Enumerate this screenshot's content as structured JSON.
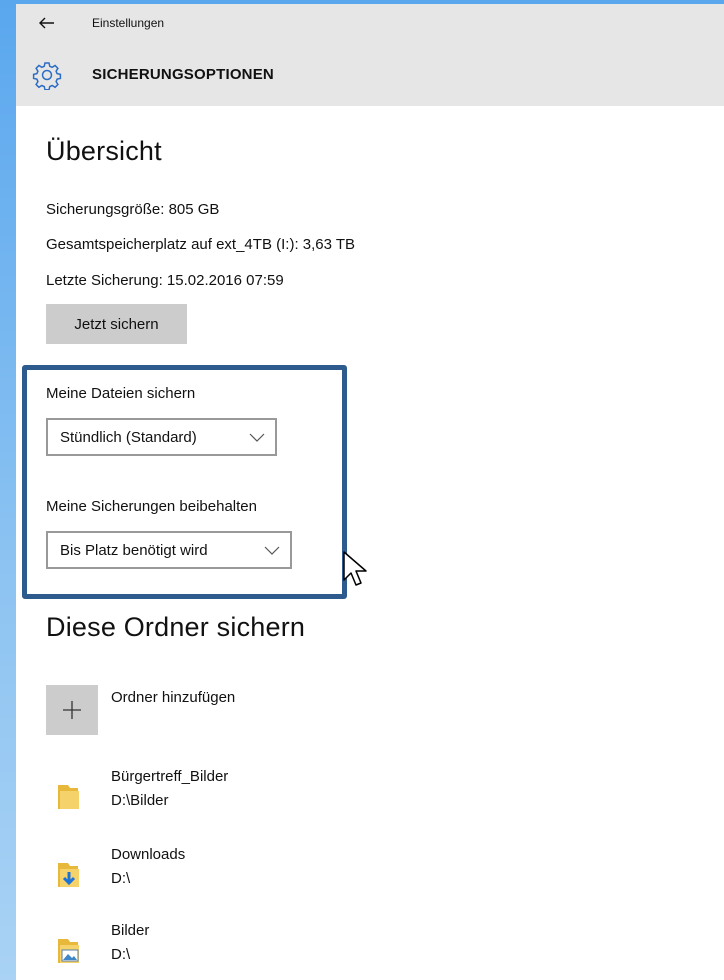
{
  "titlebar": {
    "back_icon": "back-arrow-icon",
    "app_title": "Einstellungen",
    "page_icon": "gear-icon",
    "page_heading": "SICHERUNGSOPTIONEN"
  },
  "overview": {
    "heading": "Übersicht",
    "backup_size": "Sicherungsgröße: 805 GB",
    "total_storage": "Gesamtspeicherplatz auf ext_4TB (I:): 3,63 TB",
    "last_backup": "Letzte Sicherung: 15.02.2016 07:59",
    "backup_now_label": "Jetzt sichern"
  },
  "settings": {
    "backup_files_label": "Meine Dateien sichern",
    "backup_files_value": "Stündlich (Standard)",
    "keep_backups_label": "Meine Sicherungen beibehalten",
    "keep_backups_value": "Bis Platz benötigt wird",
    "highlight_color": "#2e5b8e"
  },
  "folders": {
    "heading": "Diese Ordner sichern",
    "add_label": "Ordner hinzufügen",
    "items": [
      {
        "name": "Bürgertreff_Bilder",
        "path": "D:\\Bilder",
        "icon": "folder-icon"
      },
      {
        "name": "Downloads",
        "path": "D:\\",
        "icon": "downloads-folder-icon"
      },
      {
        "name": "Bilder",
        "path": "D:\\",
        "icon": "pictures-folder-icon"
      }
    ]
  }
}
